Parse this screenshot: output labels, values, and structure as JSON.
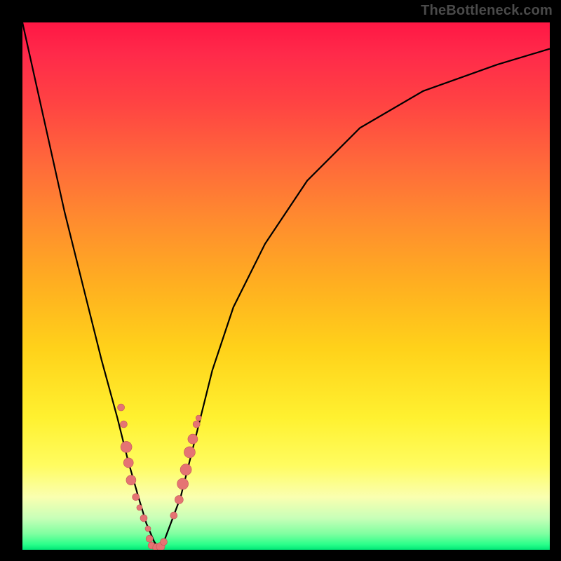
{
  "watermark": "TheBottleneck.com",
  "chart_data": {
    "type": "line",
    "title": "",
    "xlabel": "",
    "ylabel": "",
    "xlim": [
      0,
      100
    ],
    "ylim": [
      0,
      100
    ],
    "grid": false,
    "legend": false,
    "curve": {
      "x": [
        0,
        4,
        8,
        12,
        15,
        18,
        20,
        22,
        23.5,
        25,
        26,
        27,
        30,
        33,
        36,
        40,
        46,
        54,
        64,
        76,
        90,
        100
      ],
      "y": [
        100,
        82,
        64,
        48,
        36,
        25,
        17,
        10,
        5,
        1.5,
        0.2,
        2,
        10,
        22,
        34,
        46,
        58,
        70,
        80,
        87,
        92,
        95
      ]
    },
    "minimum_x": 25.5,
    "markers": [
      {
        "x": 18.7,
        "y": 27.0,
        "r": 5
      },
      {
        "x": 19.2,
        "y": 23.8,
        "r": 5
      },
      {
        "x": 19.7,
        "y": 19.5,
        "r": 8
      },
      {
        "x": 20.1,
        "y": 16.5,
        "r": 7
      },
      {
        "x": 20.6,
        "y": 13.2,
        "r": 7
      },
      {
        "x": 21.5,
        "y": 10.0,
        "r": 5
      },
      {
        "x": 22.2,
        "y": 8.0,
        "r": 4
      },
      {
        "x": 23.0,
        "y": 6.0,
        "r": 5
      },
      {
        "x": 23.8,
        "y": 4.0,
        "r": 4
      },
      {
        "x": 24.1,
        "y": 2.1,
        "r": 5
      },
      {
        "x": 24.5,
        "y": 0.8,
        "r": 5
      },
      {
        "x": 25.5,
        "y": 0.4,
        "r": 6
      },
      {
        "x": 26.2,
        "y": 0.6,
        "r": 6
      },
      {
        "x": 26.8,
        "y": 1.5,
        "r": 5
      },
      {
        "x": 28.7,
        "y": 6.5,
        "r": 5
      },
      {
        "x": 29.7,
        "y": 9.5,
        "r": 6
      },
      {
        "x": 30.4,
        "y": 12.5,
        "r": 8
      },
      {
        "x": 31.0,
        "y": 15.2,
        "r": 8
      },
      {
        "x": 31.7,
        "y": 18.5,
        "r": 8
      },
      {
        "x": 32.3,
        "y": 21.0,
        "r": 7
      },
      {
        "x": 33.0,
        "y": 23.8,
        "r": 5
      },
      {
        "x": 33.4,
        "y": 25.0,
        "r": 4
      }
    ],
    "colors": {
      "curve": "#000000",
      "marker_fill": "#e57373",
      "marker_stroke": "#c05555"
    }
  }
}
